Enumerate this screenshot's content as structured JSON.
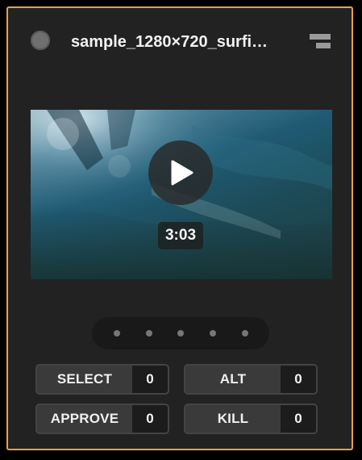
{
  "card": {
    "title": "sample_1280×720_surfi…",
    "accent_color": "#e8a04a",
    "status_icon": "status-dot-icon",
    "menu_icon": "stack-menu-icon"
  },
  "video": {
    "duration": "3:03",
    "play_icon": "play-icon"
  },
  "pager": {
    "page_count": 5
  },
  "counters": [
    {
      "label": "SELECT",
      "count": "0"
    },
    {
      "label": "ALT",
      "count": "0"
    },
    {
      "label": "APPROVE",
      "count": "0"
    },
    {
      "label": "KILL",
      "count": "0"
    }
  ]
}
